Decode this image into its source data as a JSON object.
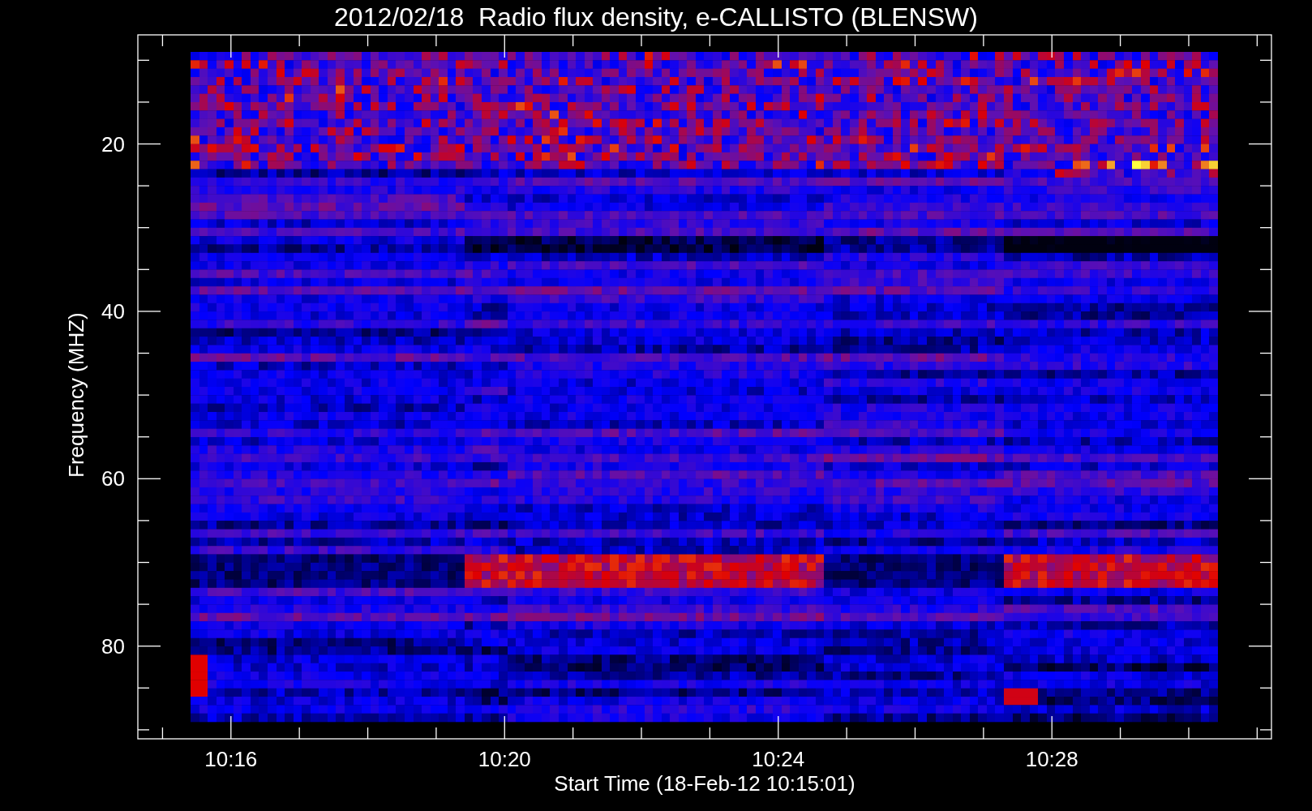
{
  "plot": {
    "title": "2012/02/18  Radio flux density, e-CALLISTO (BLENSW)",
    "ylabel": "Frequency (MHZ)",
    "yticks": [
      "20",
      "40",
      "60",
      "80"
    ],
    "xticks": [
      "10:16",
      "10:20",
      "10:24",
      "10:28"
    ],
    "xlabel": "Start Time (18-Feb-12 10:15:01)"
  }
}
